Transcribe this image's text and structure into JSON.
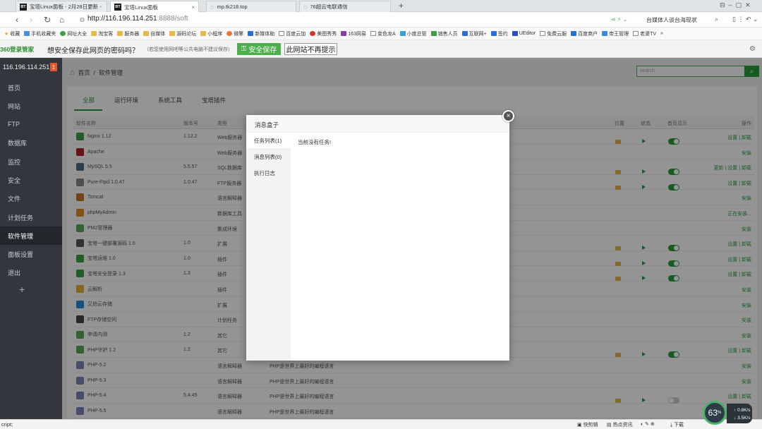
{
  "browser": {
    "tabs": [
      {
        "label": "宝塔Linux面板 - 2月28日更新 -",
        "icon": "bt-icon",
        "active": false
      },
      {
        "label": "宝塔Linux面板",
        "icon": "bt-icon",
        "active": true
      },
      {
        "label": "mp.tk218.top",
        "icon": "globe-icon",
        "active": false
      },
      {
        "label": "76超云电联通信",
        "icon": "globe-icon",
        "active": false
      }
    ],
    "new_tab": "+",
    "url_host": "http://116.196.114.251",
    "url_path": ":8888/soft",
    "search_hint": "台媒体人谈台海现状",
    "bookmarks": [
      "收藏",
      "手机收藏夹",
      "网址大全",
      "淘宝客",
      "服务器",
      "自媒体",
      "源码论坛",
      "小程序",
      "微擎",
      "新媒体助",
      "百度云加",
      "美图秀秀",
      "163网易",
      "变色龙A",
      "小度总管",
      "销售人员",
      "互联网+",
      "签约",
      "UEditor",
      "免费云服",
      "百度商户",
      "帝王管理",
      "老婆TV"
    ],
    "more_bookmarks": "»"
  },
  "password_bar": {
    "logo": "360登录管家",
    "question": "想安全保存此网页的密码吗？",
    "note": "（若您使用网吧等公共电脑不建议保存）",
    "save": "安全保存",
    "never": "此网站不再提示"
  },
  "sidebar": {
    "ip": "116.196.114.251",
    "badge": "1",
    "items": [
      {
        "label": "首页",
        "name": "home"
      },
      {
        "label": "网站",
        "name": "website"
      },
      {
        "label": "FTP",
        "name": "ftp"
      },
      {
        "label": "数据库",
        "name": "database"
      },
      {
        "label": "监控",
        "name": "monitor"
      },
      {
        "label": "安全",
        "name": "security"
      },
      {
        "label": "文件",
        "name": "files"
      },
      {
        "label": "计划任务",
        "name": "cron"
      },
      {
        "label": "软件管理",
        "name": "software"
      },
      {
        "label": "面板设置",
        "name": "settings"
      },
      {
        "label": "退出",
        "name": "logout"
      }
    ],
    "plus": "+"
  },
  "main": {
    "breadcrumb_home": "首页",
    "breadcrumb_sep": "/",
    "breadcrumb_current": "软件管理",
    "search_placeholder": "search",
    "tabs": [
      "全部",
      "运行环境",
      "系统工具",
      "宝塔插件"
    ],
    "headers": [
      "软件名称",
      "版本号",
      "类型",
      "位置",
      "状态",
      "首页显示",
      "操作"
    ],
    "rows": [
      {
        "name": "Nginx 1.12",
        "version": "1.12.2",
        "type": "Web服务器",
        "desc": "",
        "installed": true,
        "home": true,
        "ops": "设置 | 卸载",
        "color": "#3aa142"
      },
      {
        "name": "Apache",
        "version": "",
        "type": "Web服务器",
        "desc": "",
        "installed": false,
        "home": null,
        "ops": "安装",
        "color": "#b0222b"
      },
      {
        "name": "MySQL 5.5",
        "version": "5.5.57",
        "type": "SQL数据库",
        "desc": "",
        "installed": true,
        "home": true,
        "ops": "更新 | 设置 | 卸载",
        "color": "#4a6d8c"
      },
      {
        "name": "Pure-Ftpd 1.0.47",
        "version": "1.0.47",
        "type": "FTP服务器",
        "desc": "",
        "installed": true,
        "home": true,
        "ops": "设置 | 卸载",
        "color": "#888888"
      },
      {
        "name": "Tomcat",
        "version": "",
        "type": "语言解释器",
        "desc": "",
        "installed": false,
        "home": null,
        "ops": "安装",
        "color": "#c5782a"
      },
      {
        "name": "phpMyAdmin",
        "version": "",
        "type": "数据库工具",
        "desc": "",
        "installed": false,
        "home": null,
        "ops": "正在安装...",
        "color": "#e08b2a"
      },
      {
        "name": "PM2管理器",
        "version": "",
        "type": "集成环境",
        "desc": "",
        "installed": false,
        "home": null,
        "ops": "安装",
        "color": "#5aa65a"
      },
      {
        "name": "宝塔一键部署源码 1.0",
        "version": "1.0",
        "type": "扩展",
        "desc": "",
        "installed": true,
        "home": true,
        "ops": "设置 | 卸载",
        "color": "#555555"
      },
      {
        "name": "宝塔运维 1.0",
        "version": "1.0",
        "type": "插件",
        "desc": "",
        "installed": true,
        "home": true,
        "ops": "设置 | 卸载",
        "color": "#3aa142"
      },
      {
        "name": "宝塔安全登录 1.3",
        "version": "1.3",
        "type": "插件",
        "desc": "",
        "installed": true,
        "home": true,
        "ops": "设置 | 卸载",
        "color": "#3aa142"
      },
      {
        "name": "云解析",
        "version": "",
        "type": "插件",
        "desc": "",
        "installed": false,
        "home": null,
        "ops": "安装",
        "color": "#e0b03a"
      },
      {
        "name": "又拍云存储",
        "version": "",
        "type": "扩展",
        "desc": "",
        "installed": false,
        "home": null,
        "ops": "安装",
        "color": "#2a8ad8"
      },
      {
        "name": "FTP存储空间",
        "version": "",
        "type": "计划任务",
        "desc": "",
        "installed": false,
        "home": null,
        "ops": "安装",
        "color": "#444444"
      },
      {
        "name": "申请内测",
        "version": "1.2",
        "type": "其它",
        "desc": "",
        "installed": false,
        "home": null,
        "ops": "安装",
        "color": "#5aa65a"
      },
      {
        "name": "PHP守护 1.2",
        "version": "1.2",
        "type": "其它",
        "desc": "",
        "installed": true,
        "home": true,
        "ops": "设置 | 卸载",
        "color": "#5aa65a"
      },
      {
        "name": "PHP-5.2",
        "version": "",
        "type": "语言解释器",
        "desc": "PHP是世界上最好的编程语言",
        "installed": false,
        "home": null,
        "ops": "安装",
        "color": "#7b86b6"
      },
      {
        "name": "PHP-5.3",
        "version": "",
        "type": "语言解释器",
        "desc": "PHP是世界上最好的编程语言",
        "installed": false,
        "home": null,
        "ops": "安装",
        "color": "#7b86b6"
      },
      {
        "name": "PHP-5.4",
        "version": "5.4.45",
        "type": "语言解释器",
        "desc": "PHP是世界上最好的编程语言",
        "installed": true,
        "home": false,
        "ops": "设置 | 卸载",
        "color": "#7b86b6"
      },
      {
        "name": "PHP-5.5",
        "version": "",
        "type": "语言解释器",
        "desc": "PHP是世界上最好的编程语言",
        "installed": false,
        "home": null,
        "ops": "安装",
        "color": "#7b86b6"
      }
    ]
  },
  "modal": {
    "title": "消息盒子",
    "tabs": [
      "任务列表(1)",
      "消息列表(0)",
      "执行日志"
    ],
    "empty": "当前没有任务!",
    "close": "×"
  },
  "statusbar": {
    "text": "cript;",
    "items": [
      "快剪辑",
      "热点资讯",
      "下载"
    ],
    "cpu": "63",
    "up": "0.8K/s",
    "down": "3.5K/s"
  },
  "colors": {
    "accent": "#279f3c",
    "sidebar": "#33363c",
    "badge": "#e5572b"
  }
}
